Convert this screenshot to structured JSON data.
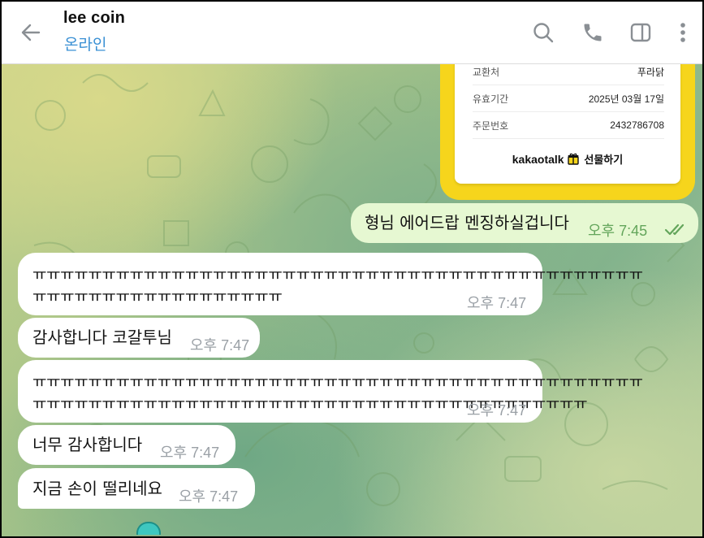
{
  "header": {
    "title": "lee coin",
    "status": "온라인"
  },
  "gift_card": {
    "rows": [
      {
        "key": "교환처",
        "value": "푸라닭"
      },
      {
        "key": "유효기간",
        "value": "2025년 03월 17일"
      },
      {
        "key": "주문번호",
        "value": "2432786708"
      }
    ],
    "brand_kakaotalk": "kakaotalk",
    "brand_gift": "선물하기"
  },
  "messages": [
    {
      "dir": "out",
      "lines": [
        "형님 에어드랍 멘징하실겁니다"
      ],
      "time": "오후 7:45",
      "read": true
    },
    {
      "dir": "in",
      "lines": [
        "ㅠㅠㅠㅠㅠㅠㅠㅠㅠㅠㅠㅠㅠㅠㅠㅠㅠㅠㅠㅠㅠㅠㅠㅠㅠㅠㅠㅠㅠㅠㅠㅠㅠㅠㅠㅠㅠㅠㅠㅠㅠㅠㅠㅠ",
        "ㅠㅠㅠㅠㅠㅠㅠㅠㅠㅠㅠㅠㅠㅠㅠㅠㅠㅠ"
      ],
      "time": "오후 7:47"
    },
    {
      "dir": "in",
      "lines": [
        "감사합니다 코갈투님"
      ],
      "time": "오후 7:47"
    },
    {
      "dir": "in",
      "lines": [
        "ㅠㅠㅠㅠㅠㅠㅠㅠㅠㅠㅠㅠㅠㅠㅠㅠㅠㅠㅠㅠㅠㅠㅠㅠㅠㅠㅠㅠㅠㅠㅠㅠㅠㅠㅠㅠㅠㅠㅠㅠㅠㅠㅠㅠ",
        "ㅠㅠㅠㅠㅠㅠㅠㅠㅠㅠㅠㅠㅠㅠㅠㅠㅠㅠㅠㅠㅠㅠㅠㅠㅠㅠㅠㅠㅠㅠㅠㅠㅠㅠㅠㅠㅠㅠㅠㅠ"
      ],
      "time": "오후 7:47"
    },
    {
      "dir": "in",
      "lines": [
        "너무 감사합니다"
      ],
      "time": "오후 7:47"
    },
    {
      "dir": "in",
      "lines": [
        "지금 손이 떨리네요"
      ],
      "time": "오후 7:47"
    }
  ],
  "icons": {
    "back": "arrow-left-icon",
    "search": "search-icon",
    "call": "phone-icon",
    "sidebar": "sidebar-toggle-icon",
    "menu": "more-vertical-icon"
  },
  "colors": {
    "accent": "#3a90d4",
    "outgoing_bubble": "#e6f8d2",
    "incoming_bubble": "#ffffff",
    "read_checks": "#63a55b",
    "gift_frame": "#f6d51c"
  }
}
